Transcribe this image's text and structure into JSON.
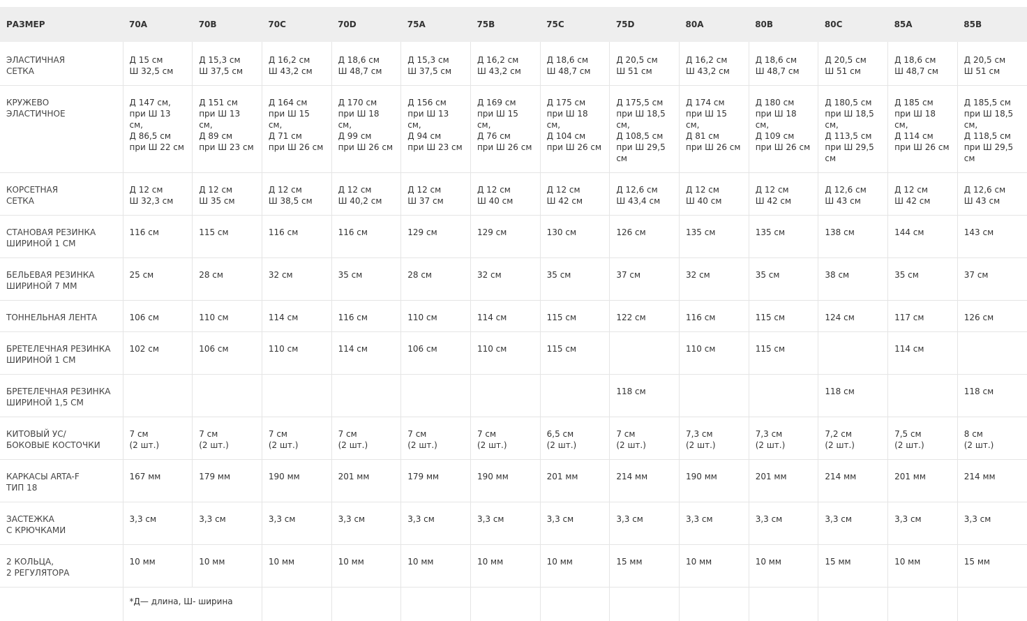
{
  "table": {
    "header_label": "РАЗМЕР",
    "sizes": [
      "70A",
      "70B",
      "70C",
      "70D",
      "75A",
      "75B",
      "75C",
      "75D",
      "80A",
      "80B",
      "80C",
      "85A",
      "85B"
    ],
    "rows": [
      {
        "label": "ЭЛАСТИЧНАЯ\nСЕТКА",
        "cells": [
          "Д 15 см\nШ 32,5 см",
          "Д 15,3 см\nШ 37,5 см",
          "Д 16,2 см\nШ 43,2 см",
          "Д 18,6 см\nШ 48,7 см",
          "Д 15,3 см\nШ 37,5 см",
          "Д 16,2 см\nШ 43,2 см",
          "Д 18,6 см\nШ 48,7 см",
          "Д 20,5 см\nШ 51 см",
          "Д 16,2 см\nШ 43,2 см",
          "Д 18,6 см\nШ 48,7 см",
          "Д  20,5 см\nШ 51 см",
          "Д 18,6 см\nШ 48,7 см",
          "Д 20,5 см\nШ 51 см"
        ]
      },
      {
        "label": "КРУЖЕВО\nЭЛАСТИЧНОЕ",
        "cells": [
          "Д 147 см,\nпри Ш 13 см,\nД 86,5 см\nпри Ш 22 см",
          "Д 151 см\nпри Ш 13 см,\nД 89 см\nпри Ш 23 см",
          "Д 164 см\nпри Ш 15 см,\nД 71 см\nпри Ш 26 см",
          "Д 170 см\nпри Ш 18 см,\nД 99 см\nпри Ш 26 см",
          "Д 156 см\nпри Ш 13 см,\nД 94 см\nпри Ш 23 см",
          "Д 169 см\nпри Ш 15 см,\nД 76 см\nпри Ш 26 см",
          "Д 175 см\nпри Ш 18 см,\nД 104 см\nпри Ш 26 см",
          "Д 175,5 см\nпри Ш 18,5 см,\nД 108,5 см\nпри Ш 29,5 см",
          "Д 174 см\nпри Ш 15 см,\nД 81 см\nпри Ш 26 см",
          "Д 180 см\nпри Ш 18 см,\nД 109 см\nпри Ш 26 см",
          "Д 180,5 см\nпри Ш 18,5 см,\nД 113,5 см\nпри Ш 29,5 см",
          "Д 185 см\nпри Ш 18 см,\nД 114 см\nпри Ш 26 см",
          "Д 185,5 см\nпри Ш 18,5 см,\nД 118,5 см\nпри Ш 29,5 см"
        ]
      },
      {
        "label": "КОРСЕТНАЯ\nСЕТКА",
        "cells": [
          "Д 12 см\nШ 32,3 см",
          "Д 12 см\nШ 35 см",
          "Д 12 см\nШ 38,5 см",
          "Д 12 см\nШ 40,2 см",
          "Д 12 см\nШ 37 см",
          "Д 12 см\nШ 40 см",
          "Д 12 см\nШ 42 см",
          "Д 12,6 см\nШ 43,4 см",
          "Д 12 см\nШ 40 см",
          "Д 12 см\nШ 42 см",
          "Д 12,6 см\nШ 43 см",
          "Д 12 см\nШ 42 см",
          "Д 12,6 см\nШ 43 см"
        ]
      },
      {
        "label": "СТАНОВАЯ РЕЗИНКА\nШИРИНОЙ 1 СМ",
        "cells": [
          "116 см",
          "115 см",
          "116 см",
          "116 см",
          "129 см",
          "129 см",
          "130 см",
          "126 см",
          "135 см",
          "135 см",
          "138 см",
          "144 см",
          "143 см"
        ]
      },
      {
        "label": "БЕЛЬЕВАЯ РЕЗИНКА\nШИРИНОЙ 7 ММ",
        "cells": [
          "25 см",
          "28 см",
          "32 см",
          "35 см",
          "28 см",
          "32 см",
          "35 см",
          "37 см",
          "32 см",
          "35 см",
          "38 см",
          "35 см",
          "37 см"
        ]
      },
      {
        "label": "ТОННЕЛЬНАЯ ЛЕНТА",
        "cells": [
          "106 см",
          "110 см",
          "114 см",
          "116 см",
          "110 см",
          "114 см",
          "115 см",
          "122 см",
          "116 см",
          "115 см",
          "124 см",
          "117 см",
          "126 см"
        ]
      },
      {
        "label": "БРЕТЕЛЕЧНАЯ РЕЗИНКА\nШИРИНОЙ 1 СМ",
        "cells": [
          "102 см",
          "106 см",
          " 110 см",
          "114 см",
          "106 см",
          "110 см",
          "115 см",
          "",
          "110 см",
          "115 см",
          "",
          "114 см",
          ""
        ]
      },
      {
        "label": "БРЕТЕЛЕЧНАЯ РЕЗИНКА\nШИРИНОЙ 1,5 СМ",
        "cells": [
          "",
          "",
          "",
          "",
          "",
          "",
          "",
          "118 см",
          "",
          "",
          "118 см",
          "",
          "118 см"
        ]
      },
      {
        "label": "КИТОВЫЙ УС/\nБОКОВЫЕ КОСТОЧКИ",
        "cells": [
          "7 см\n(2 шт.)",
          "7 см\n(2 шт.)",
          "7 см\n(2 шт.)",
          "7 см\n(2 шт.)",
          "7 см\n(2 шт.)",
          "7 см\n(2 шт.)",
          "6,5 см\n(2 шт.)",
          "7 см\n(2 шт.)",
          "7,3 см\n(2 шт.)",
          "7,3 см\n(2 шт.)",
          "7,2 см\n(2 шт.)",
          "7,5 см\n(2 шт.)",
          "8 см\n(2 шт.)"
        ]
      },
      {
        "label": "КАРКАСЫ ARTA-F\nТИП 18",
        "cells": [
          "167 мм",
          "179 мм",
          "190 мм",
          "201 мм",
          "179 мм",
          "190 мм",
          "201 мм",
          "214 мм",
          "190 мм",
          "201 мм",
          "214 мм",
          "201 мм",
          "214 мм"
        ]
      },
      {
        "label": "ЗАСТЕЖКА\nС КРЮЧКАМИ",
        "cells": [
          "3,3 см",
          "3,3 см",
          "3,3 см",
          "3,3 см",
          "3,3 см",
          "3,3 см",
          "3,3 см",
          "3,3 см",
          "3,3 см",
          "3,3 см",
          "3,3 см",
          "3,3 см",
          "3,3 см"
        ]
      },
      {
        "label": "2 КОЛЬЦА,\n2 РЕГУЛЯТОРА",
        "cells": [
          "10 мм",
          "10 мм",
          "10 мм",
          "10 мм",
          "10 мм",
          "10 мм",
          "10 мм",
          "15 мм",
          "10 мм",
          "10 мм",
          "15 мм",
          "10 мм",
          "15 мм"
        ]
      }
    ],
    "note": "*Д— длина, Ш- ширина"
  }
}
